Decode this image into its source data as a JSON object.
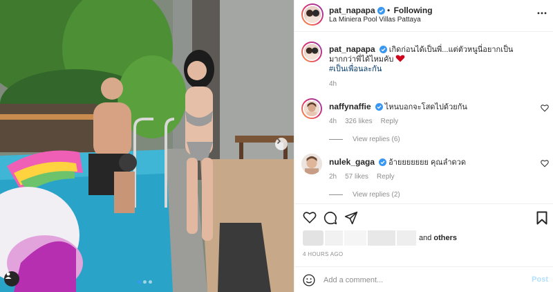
{
  "header": {
    "username": "pat_napapa",
    "separator": " • ",
    "follow_label": "Following",
    "location": "La Miniera Pool Villas Pattaya"
  },
  "caption": {
    "username": "pat_napapa",
    "text": "เกิดก่อนได้เป็นพี่...แต่ตัวหนูนี่อยากเป็นมากกว่าพี่ได้ไหมคับ",
    "hashtag": "#เป็นเพื่อนละกัน",
    "time": "4h"
  },
  "comments": [
    {
      "username": "naffynaffie",
      "text": "ไหนบอกจะโสดไปด้วยกัน",
      "time": "4h",
      "likes": "326 likes",
      "reply_label": "Reply",
      "view_replies": "View replies (6)"
    },
    {
      "username": "nulek_gaga",
      "text": "อ้ายยยยยยย คุณลำดวด",
      "time": "2h",
      "likes": "57 likes",
      "reply_label": "Reply",
      "view_replies": "View replies (2)"
    }
  ],
  "likes_summary": {
    "and": "and",
    "others": "others"
  },
  "post_time": "4 HOURS AGO",
  "comment_box": {
    "placeholder": "Add a comment...",
    "post_label": "Post"
  },
  "carousel": {
    "total": 3,
    "active": 1
  },
  "colors": {
    "verified": "#3897f0",
    "post_disabled": "#b2dffc",
    "hashtag": "#00376b",
    "muted": "#8e8e8e"
  },
  "icons": [
    "verified-icon",
    "more-icon",
    "heart-icon",
    "comment-icon",
    "share-icon",
    "bookmark-icon",
    "emoji-icon",
    "chevron-right-icon",
    "user-tag-icon"
  ]
}
